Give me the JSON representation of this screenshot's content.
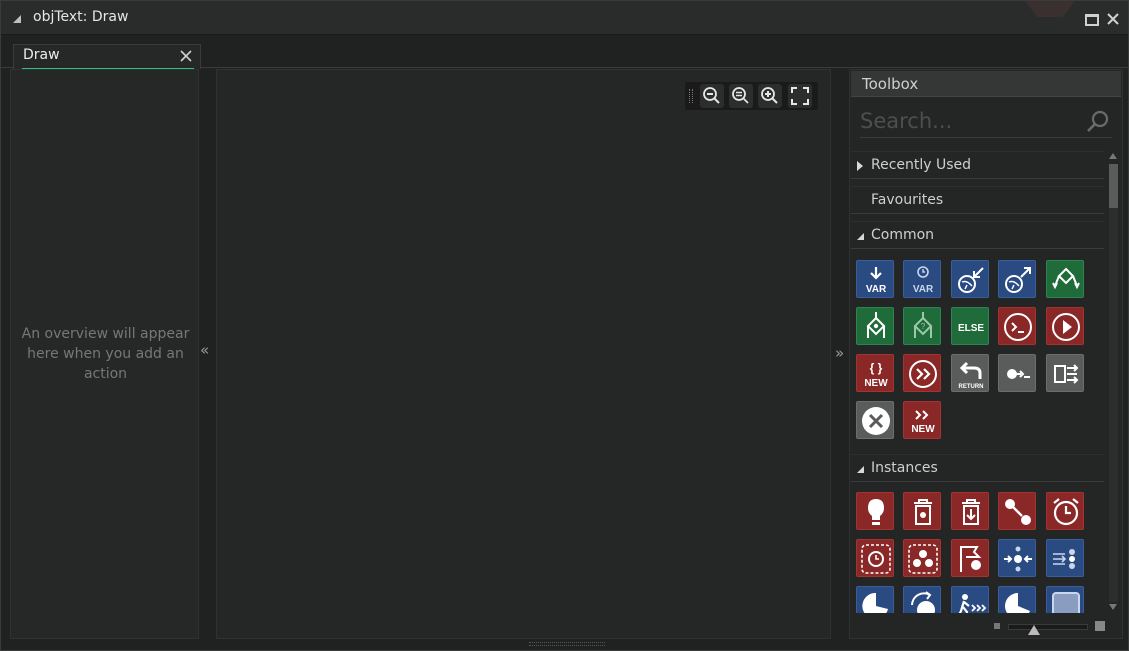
{
  "window": {
    "title": "objText: Draw"
  },
  "tabs": [
    {
      "label": "Draw",
      "active": true
    }
  ],
  "overview": {
    "empty_message": "An overview will appear here when you add an action"
  },
  "zoom": {
    "buttons": [
      "zoom-out",
      "zoom-reset",
      "zoom-in",
      "fit-to-screen"
    ]
  },
  "toolbox": {
    "title": "Toolbox",
    "search": {
      "placeholder": "Search...",
      "value": ""
    },
    "sections": [
      {
        "label": "Recently Used",
        "expanded": false
      },
      {
        "label": "Favourites",
        "expanded": false
      },
      {
        "label": "Common",
        "expanded": true
      },
      {
        "label": "Instances",
        "expanded": true
      }
    ],
    "common_icons": [
      {
        "name": "assign-variable",
        "color": "blue",
        "text": "VAR"
      },
      {
        "name": "assign-temp-variable",
        "color": "blue",
        "text": "VAR"
      },
      {
        "name": "declare-global",
        "color": "blue"
      },
      {
        "name": "get-global",
        "color": "blue"
      },
      {
        "name": "if-variable",
        "color": "green"
      },
      {
        "name": "if-expression",
        "color": "green"
      },
      {
        "name": "if-expression-alt",
        "color": "green"
      },
      {
        "name": "else",
        "color": "green",
        "text": "ELSE"
      },
      {
        "name": "execute-code",
        "color": "red"
      },
      {
        "name": "function-call",
        "color": "red"
      },
      {
        "name": "declare-new-struct",
        "color": "red",
        "text": "NEW"
      },
      {
        "name": "call-user-event",
        "color": "red"
      },
      {
        "name": "return",
        "color": "grey",
        "text": "RETURN"
      },
      {
        "name": "execute-script",
        "color": "grey"
      },
      {
        "name": "switch",
        "color": "grey"
      },
      {
        "name": "exit-event",
        "color": "grey"
      },
      {
        "name": "new-constructor",
        "color": "red",
        "text": "NEW"
      }
    ],
    "instances_icons": [
      {
        "name": "create-instance",
        "color": "red"
      },
      {
        "name": "destroy-instance",
        "color": "red"
      },
      {
        "name": "destroy-at-position",
        "color": "red"
      },
      {
        "name": "change-instance",
        "color": "red"
      },
      {
        "name": "set-alarm",
        "color": "red"
      },
      {
        "name": "get-alarm",
        "color": "red"
      },
      {
        "name": "instance-count",
        "color": "red"
      },
      {
        "name": "instance-exists",
        "color": "red"
      },
      {
        "name": "jump-to-point",
        "color": "blue"
      },
      {
        "name": "move-towards",
        "color": "blue"
      },
      {
        "name": "set-speed",
        "color": "blue"
      },
      {
        "name": "set-direction",
        "color": "blue"
      },
      {
        "name": "set-path",
        "color": "blue"
      },
      {
        "name": "bounce",
        "color": "blue"
      },
      {
        "name": "wrap-room",
        "color": "blue"
      }
    ]
  }
}
